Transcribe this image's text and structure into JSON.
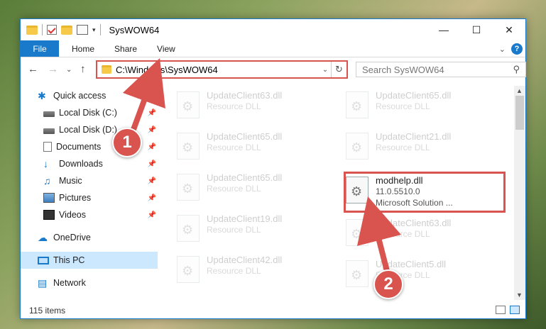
{
  "window": {
    "title": "SysWOW64"
  },
  "ribbon": {
    "tabs": [
      "File",
      "Home",
      "Share",
      "View"
    ],
    "help": "?"
  },
  "nav": {
    "address": "C:\\Windows\\SysWOW64",
    "search_placeholder": "Search SysWOW64"
  },
  "sidebar": {
    "items": [
      {
        "label": "Quick access",
        "icon": "star-icon"
      },
      {
        "label": "Local Disk (C:)",
        "icon": "disk-icon",
        "pinned": true
      },
      {
        "label": "Local Disk (D:)",
        "icon": "disk-icon",
        "pinned": true
      },
      {
        "label": "Documents",
        "icon": "document-icon",
        "pinned": true
      },
      {
        "label": "Downloads",
        "icon": "download-icon",
        "pinned": true
      },
      {
        "label": "Music",
        "icon": "music-icon",
        "pinned": true
      },
      {
        "label": "Pictures",
        "icon": "pictures-icon",
        "pinned": true
      },
      {
        "label": "Videos",
        "icon": "videos-icon",
        "pinned": true
      },
      {
        "label": "OneDrive",
        "icon": "onedrive-icon"
      },
      {
        "label": "This PC",
        "icon": "pc-icon",
        "selected": true
      },
      {
        "label": "Network",
        "icon": "network-icon"
      }
    ]
  },
  "files": [
    {
      "name": "UpdateClient63.dll",
      "sub": "Resource DLL"
    },
    {
      "name": "UpdateClient65.dll",
      "sub": "Resource DLL"
    },
    {
      "name": "UpdateClient65.dll",
      "sub": "Resource DLL"
    },
    {
      "name": "UpdateClient21.dll",
      "sub": "Resource DLL"
    },
    {
      "name": "UpdateClient65.dll",
      "sub": "Resource DLL"
    },
    {
      "name": "modhelp.dll",
      "sub": "11.0.5510.0",
      "sub2": "Microsoft Solution ..."
    },
    {
      "name": "UpdateClient19.dll",
      "sub": "Resource DLL"
    },
    {
      "name": "UpdateClient63.dll",
      "sub": "Resource DLL"
    },
    {
      "name": "UpdateClient42.dll",
      "sub": "Resource DLL"
    },
    {
      "name": "UpdateClient5.dll",
      "sub": "Resource DLL"
    }
  ],
  "status": {
    "item_count": "115 items"
  },
  "callouts": [
    "1",
    "2"
  ],
  "colors": {
    "accent": "#1979ca",
    "highlight": "#d9534f"
  }
}
